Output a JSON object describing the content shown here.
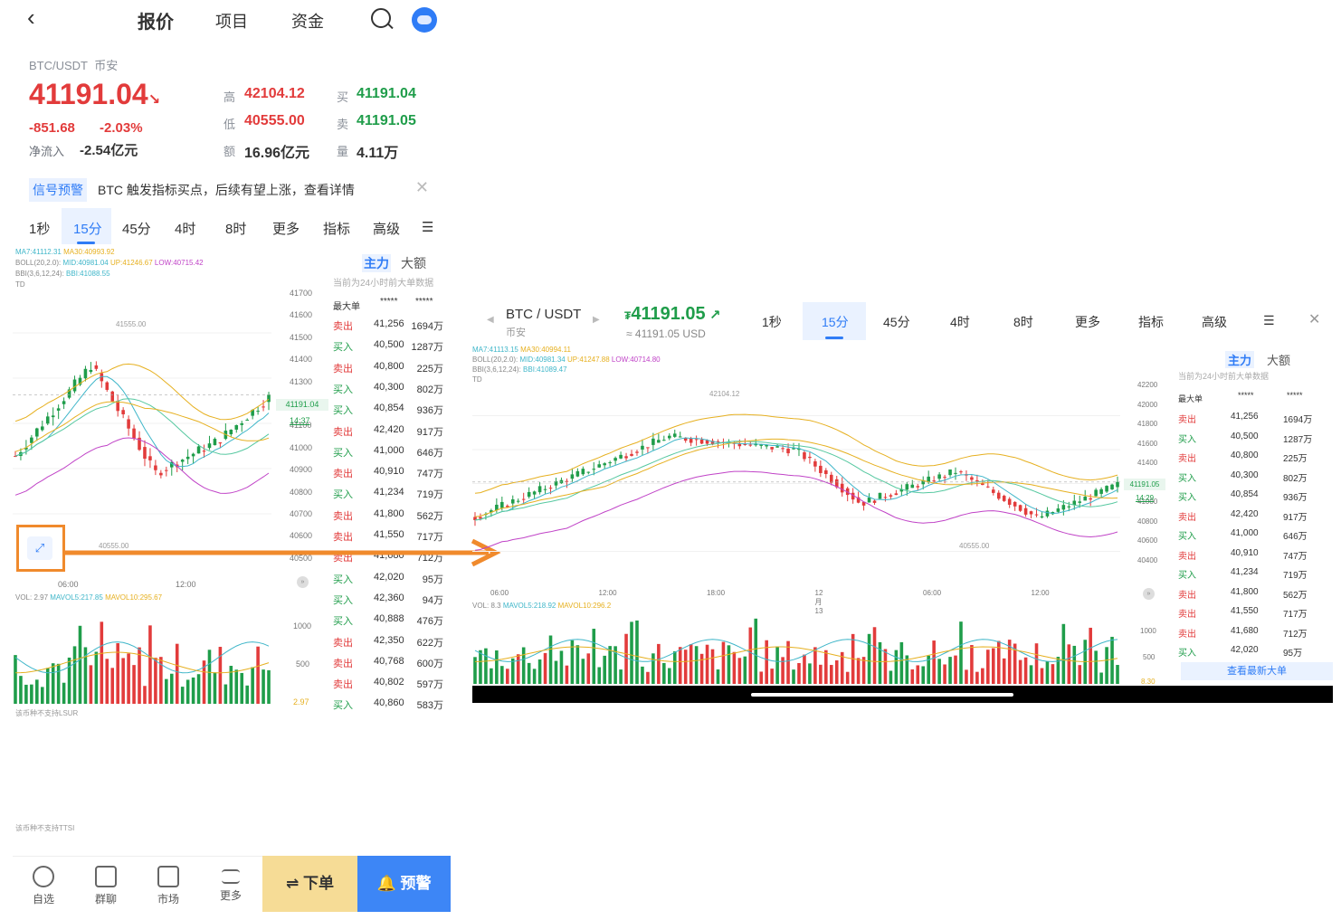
{
  "nav": {
    "tabs": [
      "报价",
      "项目",
      "资金"
    ],
    "active": "报价"
  },
  "ticker": {
    "pair": "BTC/USDT",
    "exchange": "币安",
    "price": "41191.04",
    "change": "-851.68",
    "change_pct": "-2.03%",
    "net_inflow_label": "净流入",
    "net_inflow": "-2.54亿元",
    "stats": [
      {
        "label": "高",
        "value": "42104.12",
        "color": "red"
      },
      {
        "label": "低",
        "value": "40555.00",
        "color": "red"
      },
      {
        "label": "额",
        "value": "16.96亿元",
        "color": "dark"
      },
      {
        "label": "买",
        "value": "41191.04",
        "color": "green"
      },
      {
        "label": "卖",
        "value": "41191.05",
        "color": "green"
      },
      {
        "label": "量",
        "value": "4.11万",
        "color": "dark"
      }
    ]
  },
  "signal": {
    "tag": "信号预警",
    "text": "BTC 触发指标买点，后续有望上涨，查看详情"
  },
  "timeframes": [
    "1秒",
    "15分",
    "45分",
    "4时",
    "8时",
    "更多",
    "指标",
    "高级"
  ],
  "active_timeframe": "15分",
  "left_chart": {
    "ma": "MA7:41112.31",
    "ma30": "MA30:40993.92",
    "boll": "BOLL(20,2.0):",
    "boll_mid": "MID:40981.04",
    "boll_up": "UP:41246.67",
    "boll_low": "LOW:40715.42",
    "bbi": "BBI(3,6,12,24):",
    "bbi_val": "BBI:41088.55",
    "td": "TD",
    "yaxis": [
      "41700",
      "41600",
      "41500",
      "41400",
      "41300",
      "41200",
      "41100",
      "41000",
      "40900",
      "40800",
      "40700",
      "40600",
      "40500"
    ],
    "last_price": "41191.04",
    "countdown": "14:37",
    "high_mark": "41555.00",
    "low_mark": "40555.00",
    "xaxis": [
      "06:00",
      "12:00"
    ],
    "vol": "VOL: 2.97",
    "mavol5": "MAVOL5:217.85",
    "mavol10": "MAVOL10:295.67",
    "vol_axis": [
      "1000",
      "500"
    ],
    "vol_last": "2.97",
    "lsur": "该币种不支持LSUR",
    "ttsi": "该币种不支持TTSI"
  },
  "bigorders": {
    "tabs": [
      "主力",
      "大额"
    ],
    "note": "当前为24小时前大单数据",
    "header": [
      "最大单",
      "*****",
      "*****"
    ],
    "rows": [
      {
        "side": "卖出",
        "price": "41,256",
        "amount": "1694万"
      },
      {
        "side": "买入",
        "price": "40,500",
        "amount": "1287万"
      },
      {
        "side": "卖出",
        "price": "40,800",
        "amount": "225万"
      },
      {
        "side": "买入",
        "price": "40,300",
        "amount": "802万"
      },
      {
        "side": "买入",
        "price": "40,854",
        "amount": "936万"
      },
      {
        "side": "卖出",
        "price": "42,420",
        "amount": "917万"
      },
      {
        "side": "买入",
        "price": "41,000",
        "amount": "646万"
      },
      {
        "side": "卖出",
        "price": "40,910",
        "amount": "747万"
      },
      {
        "side": "买入",
        "price": "41,234",
        "amount": "719万"
      },
      {
        "side": "卖出",
        "price": "41,800",
        "amount": "562万"
      },
      {
        "side": "卖出",
        "price": "41,550",
        "amount": "717万"
      },
      {
        "side": "卖出",
        "price": "41,680",
        "amount": "712万"
      },
      {
        "side": "买入",
        "price": "42,020",
        "amount": "95万"
      },
      {
        "side": "买入",
        "price": "42,360",
        "amount": "94万"
      },
      {
        "side": "买入",
        "price": "40,888",
        "amount": "476万"
      },
      {
        "side": "卖出",
        "price": "42,350",
        "amount": "622万"
      },
      {
        "side": "卖出",
        "price": "40,768",
        "amount": "600万"
      },
      {
        "side": "卖出",
        "price": "40,802",
        "amount": "597万"
      },
      {
        "side": "买入",
        "price": "40,860",
        "amount": "583万"
      }
    ],
    "latest_button": "查看最新大单"
  },
  "bottom_bar": [
    "自选",
    "群聊",
    "市场",
    "更多"
  ],
  "order_button": "⇌ 下单",
  "alert_button": "预警",
  "landscape": {
    "pair": "BTC / USDT",
    "exchange": "币安",
    "price": "41191.05",
    "price_prefix": "₮",
    "usd": "≈ 41191.05 USD",
    "ma": "MA7:41113.15",
    "ma30": "MA30:40994.11",
    "boll": "BOLL(20,2.0):",
    "boll_mid": "MID:40981.34",
    "boll_up": "UP:41247.88",
    "boll_low": "LOW:40714.80",
    "bbi": "BBI(3,6,12,24):",
    "bbi_val": "BBI:41089.47",
    "td": "TD",
    "yaxis": [
      "42200",
      "42000",
      "41800",
      "41600",
      "41400",
      "41200",
      "41000",
      "40800",
      "40600",
      "40400"
    ],
    "last_price": "41191.05",
    "countdown": "14:29",
    "high_mark": "42104.12",
    "low_mark": "40555.00",
    "xaxis": [
      "06:00",
      "12:00",
      "18:00",
      "12月13",
      "06:00",
      "12:00"
    ],
    "vol": "VOL: 8.3",
    "mavol5": "MAVOL5:218.92",
    "mavol10": "MAVOL10:296.2",
    "vol_axis": [
      "1000",
      "500"
    ],
    "vol_last": "8.30"
  },
  "colors": {
    "up": "#1f9d4a",
    "down": "#e23b3b",
    "accent": "#2f7cf6",
    "annotation": "#f08a2c",
    "ma7": "#3fb6c9",
    "ma30": "#e6b020",
    "boll_low": "#c043c7"
  }
}
